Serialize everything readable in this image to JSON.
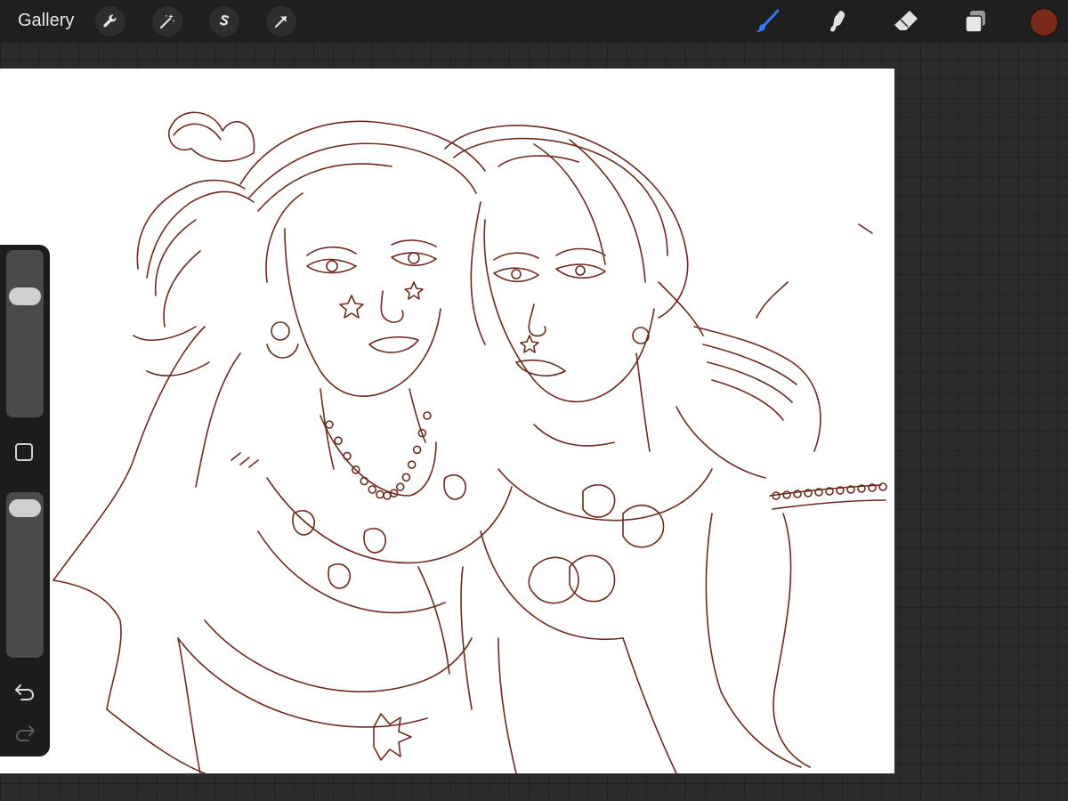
{
  "topbar": {
    "gallery_label": "Gallery",
    "left_tools": [
      "wrench-icon",
      "magic-wand-icon",
      "selection-s-icon",
      "transform-arrow-icon"
    ],
    "right_tools": [
      "brush-icon",
      "smudge-icon",
      "eraser-icon",
      "layers-icon"
    ],
    "active_tool": "brush-icon",
    "active_color": "#7a2a1a",
    "accent_color": "#2f7bf5"
  },
  "sidebar": {
    "brush_size": 0.75,
    "opacity": 0.95,
    "modify_button_icon": "square-icon",
    "undo_icon": "undo-icon",
    "redo_icon": "redo-icon"
  },
  "canvas": {
    "stroke_color": "#6e2a1c",
    "background": "#ffffff"
  }
}
